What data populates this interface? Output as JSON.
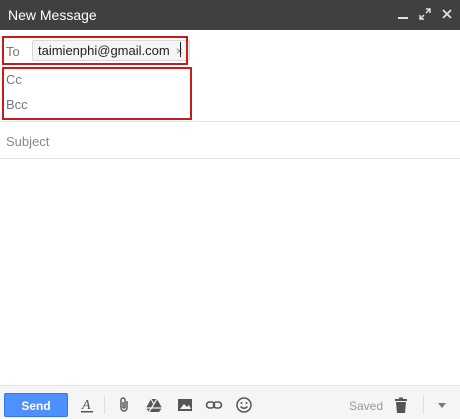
{
  "window": {
    "title": "New Message",
    "controls": [
      "minimize-icon",
      "popout-icon",
      "close-icon"
    ]
  },
  "to": {
    "label": "To",
    "recipient": "taimienphi@gmail.com",
    "remove_glyph": "×"
  },
  "cc": {
    "label": "Cc"
  },
  "bcc": {
    "label": "Bcc"
  },
  "subject": {
    "placeholder": "Subject",
    "value": ""
  },
  "toolbar": {
    "send_label": "Send",
    "status": "Saved",
    "icons": [
      "formatting-icon",
      "attach-icon",
      "drive-icon",
      "photo-icon",
      "link-icon",
      "emoji-icon",
      "trash-icon",
      "more-options-icon"
    ]
  },
  "colors": {
    "titlebar_bg": "#404040",
    "send_button": "#4d90fe",
    "highlight_box": "#c41d1d"
  }
}
